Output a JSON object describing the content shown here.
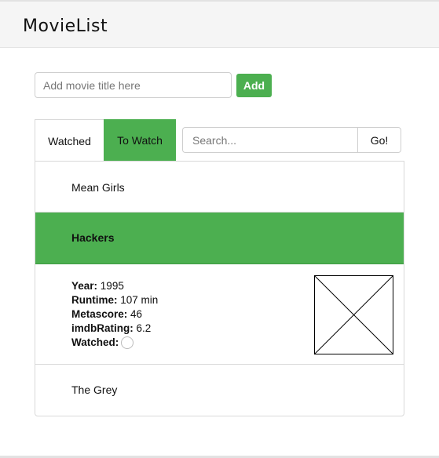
{
  "header": {
    "title": "MovieList"
  },
  "add_movie": {
    "placeholder": "Add movie title here",
    "button_label": "Add"
  },
  "tabs": [
    {
      "label": "Watched",
      "active": false
    },
    {
      "label": "To Watch",
      "active": true
    }
  ],
  "search": {
    "placeholder": "Search...",
    "button_label": "Go!"
  },
  "movies": [
    {
      "title": "Mean Girls"
    },
    {
      "title": "Hackers",
      "expanded": true,
      "details": {
        "year_label": "Year:",
        "year": "1995",
        "runtime_label": "Runtime:",
        "runtime": "107 min",
        "metascore_label": "Metascore:",
        "metascore": "46",
        "rating_label": "imdbRating:",
        "rating": "6.2",
        "watched_label": "Watched:",
        "watched": false
      },
      "poster_icon": "image-placeholder-icon"
    },
    {
      "title": "The Grey"
    }
  ],
  "colors": {
    "accent": "#4caf50",
    "border": "#d9d9d9",
    "header_bg": "#f5f5f5"
  }
}
